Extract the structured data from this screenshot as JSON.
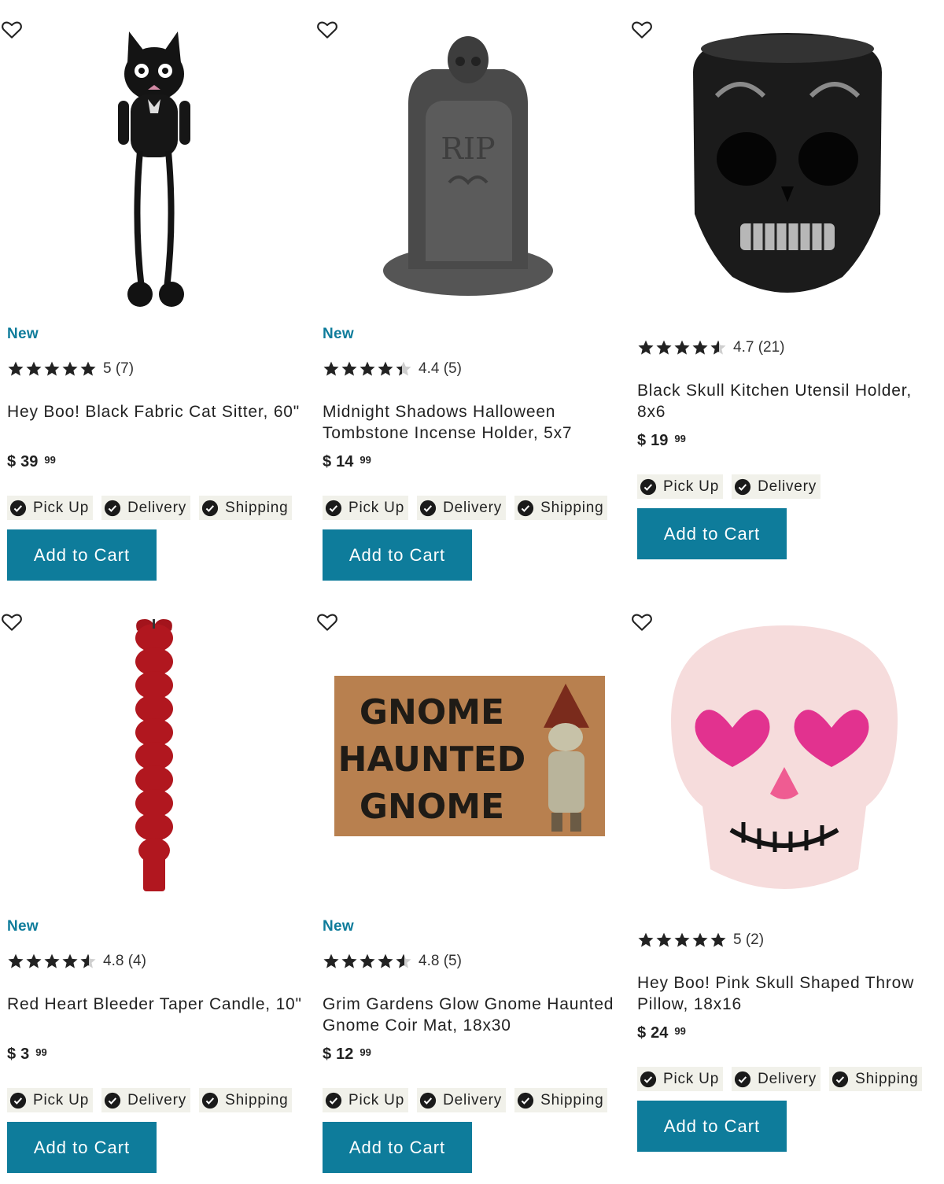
{
  "products": [
    {
      "badge": "New",
      "rating_value": 5,
      "rating_text": "5 (7)",
      "title": "Hey Boo! Black Fabric Cat Sitter, 60\"",
      "currency": "$",
      "price_dollars": "39",
      "price_cents": "99",
      "fulfillment": [
        "Pick Up",
        "Delivery",
        "Shipping"
      ],
      "add_to_cart": "Add to Cart",
      "image": "black-cat-sitter"
    },
    {
      "badge": "New",
      "rating_value": 4.4,
      "rating_text": "4.4 (5)",
      "title": "Midnight Shadows Halloween Tombstone Incense Holder, 5x7",
      "currency": "$",
      "price_dollars": "14",
      "price_cents": "99",
      "fulfillment": [
        "Pick Up",
        "Delivery",
        "Shipping"
      ],
      "add_to_cart": "Add to Cart",
      "image": "tombstone-incense-holder"
    },
    {
      "badge": "",
      "rating_value": 4.7,
      "rating_text": "4.7 (21)",
      "title": "Black Skull Kitchen Utensil Holder, 8x6",
      "currency": "$",
      "price_dollars": "19",
      "price_cents": "99",
      "fulfillment": [
        "Pick Up",
        "Delivery"
      ],
      "add_to_cart": "Add to Cart",
      "image": "black-skull-holder"
    },
    {
      "badge": "New",
      "rating_value": 4.8,
      "rating_text": "4.8 (4)",
      "title": "Red Heart Bleeder Taper Candle, 10\"",
      "currency": "$",
      "price_dollars": "3",
      "price_cents": "99",
      "fulfillment": [
        "Pick Up",
        "Delivery",
        "Shipping"
      ],
      "add_to_cart": "Add to Cart",
      "image": "red-heart-candle"
    },
    {
      "badge": "New",
      "rating_value": 4.8,
      "rating_text": "4.8 (5)",
      "title": "Grim Gardens Glow Gnome Haunted Gnome Coir Mat, 18x30",
      "currency": "$",
      "price_dollars": "12",
      "price_cents": "99",
      "fulfillment": [
        "Pick Up",
        "Delivery",
        "Shipping"
      ],
      "add_to_cart": "Add to Cart",
      "image": "gnome-coir-mat",
      "image_text": [
        "GNOME",
        "HAUNTED",
        "GNOME"
      ]
    },
    {
      "badge": "",
      "rating_value": 5,
      "rating_text": "5 (2)",
      "title": "Hey Boo! Pink Skull Shaped Throw Pillow, 18x16",
      "currency": "$",
      "price_dollars": "24",
      "price_cents": "99",
      "fulfillment": [
        "Pick Up",
        "Delivery",
        "Shipping"
      ],
      "add_to_cart": "Add to Cart",
      "image": "pink-skull-pillow"
    }
  ],
  "colors": {
    "accent": "#0e7c9b",
    "badge_bg": "#f1f1ea",
    "star": "#222222"
  }
}
